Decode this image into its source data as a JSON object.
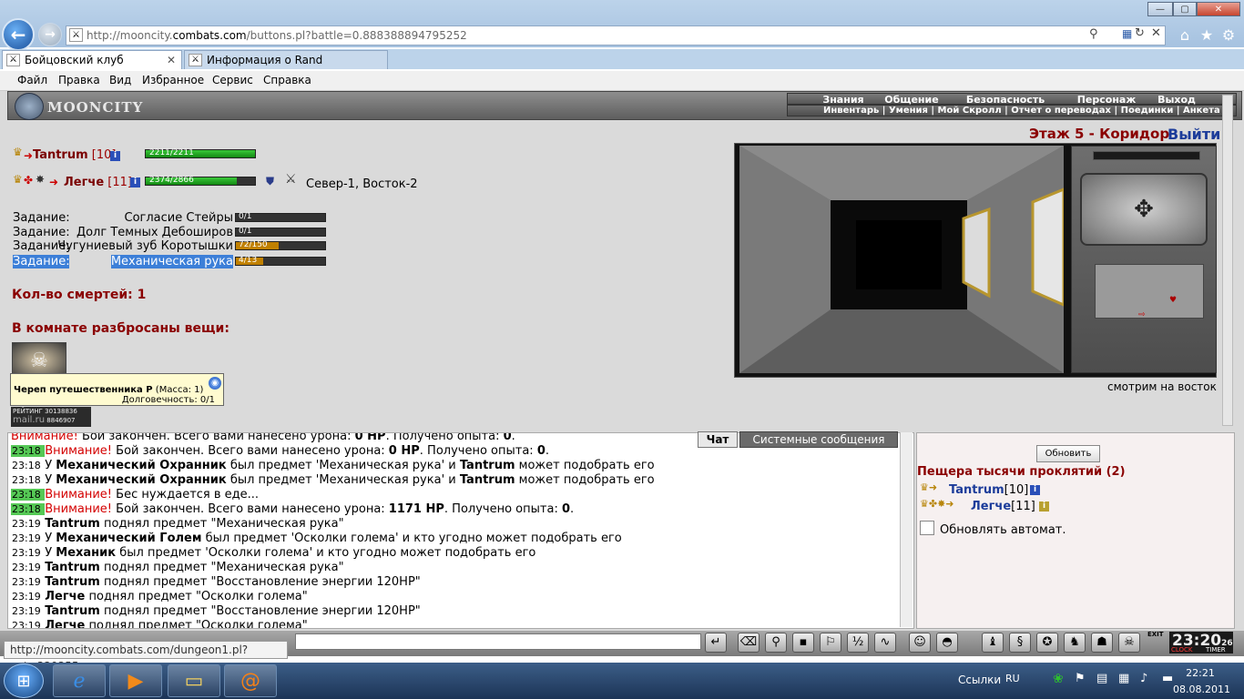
{
  "browser": {
    "url_prefix": "http://mooncity.",
    "url_domain": "combats.com",
    "url_suffix": "/buttons.pl?battle=0.888388894795252",
    "tabs": [
      {
        "label": "Бойцовский клуб"
      },
      {
        "label": "Информация о Rand"
      }
    ],
    "menu": [
      "Файл",
      "Правка",
      "Вид",
      "Избранное",
      "Сервис",
      "Справка"
    ],
    "status_url": "http://mooncity.combats.com/dungeon1.pl?get=329355"
  },
  "game": {
    "logo": "MOONCITY",
    "top_menu": [
      "Знания",
      "Общение",
      "Безопасность",
      "Персонаж",
      "Выход"
    ],
    "sub_menu": "Инвентарь | Умения | Мой Скролл | Отчет о переводах | Поединки | Анкета",
    "players": [
      {
        "name": "Tantrum",
        "level": "[10]",
        "hp": "2211/2211",
        "hp_fraction": 1.0
      },
      {
        "name": "Легче",
        "level": "[11]",
        "hp": "2374/2866",
        "hp_fraction": 0.83
      }
    ],
    "location_coords": "Север-1, Восток-2",
    "quests": [
      {
        "label": "Задание:",
        "name": "Согласие Стейры",
        "progress": "0/1",
        "fraction": 0.0,
        "color": "#c08000"
      },
      {
        "label": "Задание:",
        "name": "Долг Темных Дебоширов",
        "progress": "0/1",
        "fraction": 0.0,
        "color": "#c08000"
      },
      {
        "label": "Задание:",
        "name": "Чугуниевый зуб Коротышки",
        "progress": "72/150",
        "fraction": 0.48,
        "color": "#c08000"
      },
      {
        "label": "Задание:",
        "name": "Механическая рука",
        "progress": "4/13",
        "fraction": 0.31,
        "color": "#c08000"
      }
    ],
    "deaths": "Кол-во смертей: 1",
    "items_title": "В комнате разбросаны вещи:",
    "tooltip": {
      "name": "Череп путешественника Р",
      "mass": "(Масса: 1)",
      "durability": "Долговечность: 0/1"
    },
    "rating": {
      "label": "РЕЙТИНГ",
      "n1": "30138836",
      "n2": "8846907"
    },
    "room_title": "Этаж 5 - Коридор",
    "exit_label": "Выйти",
    "facing": "смотрим на восток"
  },
  "chat": {
    "tabs": [
      "Чат",
      "Системные сообщения"
    ],
    "lines": [
      {
        "time": "",
        "green": false,
        "html": "<span class='warn'>Внимание!</span> Бой закончен. Всего вами нанесено урона: <b>0 HP</b>. Получено опыта: <b>0</b>."
      },
      {
        "time": "23:18",
        "green": true,
        "html": "<span class='warn'>Внимание!</span> Бой закончен. Всего вами нанесено урона: <b>0 HP</b>. Получено опыта: <b>0</b>."
      },
      {
        "time": "23:18",
        "green": false,
        "html": "У <b>Механический Охранник</b> был предмет 'Механическая рука' и <b>Tantrum</b> может подобрать его"
      },
      {
        "time": "23:18",
        "green": false,
        "html": "У <b>Механический Охранник</b> был предмет 'Механическая рука' и <b>Tantrum</b> может подобрать его"
      },
      {
        "time": "23:18",
        "green": true,
        "html": "<span class='warn'>Внимание!</span> Бес нуждается в еде..."
      },
      {
        "time": "23:18",
        "green": true,
        "html": "<span class='warn'>Внимание!</span> Бой закончен. Всего вами нанесено урона: <b>1171 HP</b>. Получено опыта: <b>0</b>."
      },
      {
        "time": "23:19",
        "green": false,
        "html": "<b>Tantrum</b> поднял предмет \"Механическая рука\""
      },
      {
        "time": "23:19",
        "green": false,
        "html": "У <b>Механический Голем</b> был предмет 'Осколки голема' и кто угодно может подобрать его"
      },
      {
        "time": "23:19",
        "green": false,
        "html": "У <b>Механик</b> был предмет 'Осколки голема' и кто угодно может подобрать его"
      },
      {
        "time": "23:19",
        "green": false,
        "html": "<b>Tantrum</b> поднял предмет \"Механическая рука\""
      },
      {
        "time": "23:19",
        "green": false,
        "html": "<b>Tantrum</b> поднял предмет \"Восстановление энергии 120HP\""
      },
      {
        "time": "23:19",
        "green": false,
        "html": "<b>Легче</b> поднял предмет \"Осколки голема\""
      },
      {
        "time": "23:19",
        "green": false,
        "html": "<b>Tantrum</b> поднял предмет \"Восстановление энергии 120HP\""
      },
      {
        "time": "23:19",
        "green": false,
        "html": "<b>Легче</b> поднял предмет \"Осколки голема\""
      }
    ]
  },
  "room_panel": {
    "refresh": "Обновить",
    "title": "Пещера тысячи проклятий (2)",
    "members": [
      {
        "name": "Tantrum",
        "level": "[10]"
      },
      {
        "name": "Легче",
        "level": "[11]"
      }
    ],
    "auto_refresh": "Обновлять автомат."
  },
  "clock": {
    "time": "23:20",
    "sec": "26",
    "labels": [
      "CLOCK",
      "TIMER"
    ],
    "exit": "EXIT"
  },
  "taskbar": {
    "links": "Ссылки",
    "lang": "RU",
    "time": "22:21",
    "date": "08.08.2011"
  }
}
